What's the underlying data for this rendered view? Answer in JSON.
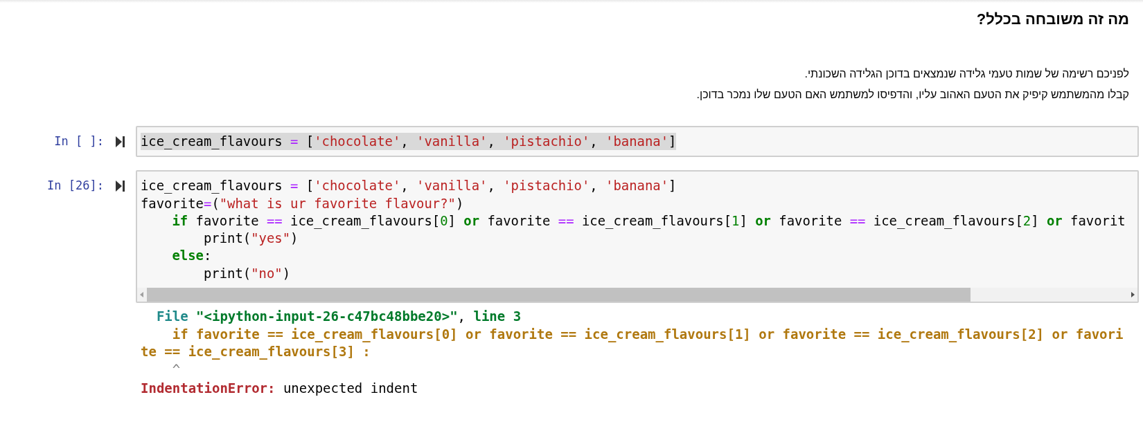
{
  "heading": "מה זה משובחה בכלל?",
  "paragraph": [
    "לפניכם רשימה של שמות טעמי גלידה שנמצאים בדוכן הגלידה השכונתי.",
    "קבלו מהמשתמש קיפיק את הטעם האהוב עליו, והדפיסו למשתמש האם הטעם שלו נמכר בדוכן."
  ],
  "cells": [
    {
      "prompt": "In [ ]:",
      "scrollbar": false,
      "lines": [
        {
          "selected": true,
          "tokens": [
            {
              "kind": "name",
              "text": "ice_cream_flavours "
            },
            {
              "kind": "op",
              "text": "="
            },
            {
              "kind": "name",
              "text": " ["
            },
            {
              "kind": "string",
              "text": "'chocolate'"
            },
            {
              "kind": "name",
              "text": ", "
            },
            {
              "kind": "string",
              "text": "'vanilla'"
            },
            {
              "kind": "name",
              "text": ", "
            },
            {
              "kind": "string",
              "text": "'pistachio'"
            },
            {
              "kind": "name",
              "text": ", "
            },
            {
              "kind": "string",
              "text": "'banana'"
            },
            {
              "kind": "name",
              "text": "]"
            }
          ]
        }
      ]
    },
    {
      "prompt": "In [26]:",
      "scrollbar": true,
      "lines": [
        {
          "selected": false,
          "tokens": [
            {
              "kind": "name",
              "text": "ice_cream_flavours "
            },
            {
              "kind": "op",
              "text": "="
            },
            {
              "kind": "name",
              "text": " ["
            },
            {
              "kind": "string",
              "text": "'chocolate'"
            },
            {
              "kind": "name",
              "text": ", "
            },
            {
              "kind": "string",
              "text": "'vanilla'"
            },
            {
              "kind": "name",
              "text": ", "
            },
            {
              "kind": "string",
              "text": "'pistachio'"
            },
            {
              "kind": "name",
              "text": ", "
            },
            {
              "kind": "string",
              "text": "'banana'"
            },
            {
              "kind": "name",
              "text": "]"
            }
          ]
        },
        {
          "selected": false,
          "tokens": [
            {
              "kind": "name",
              "text": "favorite"
            },
            {
              "kind": "op",
              "text": "="
            },
            {
              "kind": "name",
              "text": "("
            },
            {
              "kind": "string",
              "text": "\"what is ur favorite flavour?\""
            },
            {
              "kind": "name",
              "text": ")"
            }
          ]
        },
        {
          "selected": false,
          "tokens": [
            {
              "kind": "keyword",
              "text": "    if"
            },
            {
              "kind": "name",
              "text": " favorite "
            },
            {
              "kind": "op",
              "text": "=="
            },
            {
              "kind": "name",
              "text": " ice_cream_flavours["
            },
            {
              "kind": "number",
              "text": "0"
            },
            {
              "kind": "name",
              "text": "] "
            },
            {
              "kind": "keyword",
              "text": "or"
            },
            {
              "kind": "name",
              "text": " favorite "
            },
            {
              "kind": "op",
              "text": "=="
            },
            {
              "kind": "name",
              "text": " ice_cream_flavours["
            },
            {
              "kind": "number",
              "text": "1"
            },
            {
              "kind": "name",
              "text": "] "
            },
            {
              "kind": "keyword",
              "text": "or"
            },
            {
              "kind": "name",
              "text": " favorite "
            },
            {
              "kind": "op",
              "text": "=="
            },
            {
              "kind": "name",
              "text": " ice_cream_flavours["
            },
            {
              "kind": "number",
              "text": "2"
            },
            {
              "kind": "name",
              "text": "] "
            },
            {
              "kind": "keyword",
              "text": "or"
            },
            {
              "kind": "name",
              "text": " favorit"
            }
          ]
        },
        {
          "selected": false,
          "tokens": [
            {
              "kind": "name",
              "text": "        print("
            },
            {
              "kind": "string",
              "text": "\"yes\""
            },
            {
              "kind": "name",
              "text": ")"
            }
          ]
        },
        {
          "selected": false,
          "tokens": [
            {
              "kind": "keyword",
              "text": "    else"
            },
            {
              "kind": "name",
              "text": ":"
            }
          ]
        },
        {
          "selected": false,
          "tokens": [
            {
              "kind": "name",
              "text": "        print("
            },
            {
              "kind": "string",
              "text": "\"no\""
            },
            {
              "kind": "name",
              "text": ")"
            }
          ]
        }
      ]
    }
  ],
  "output": [
    {
      "kind": "traceback",
      "tokens": [
        {
          "kind": "file",
          "text": "  File "
        },
        {
          "kind": "path",
          "text": "\"<ipython-input-26-c47bc48bbe20>\""
        },
        {
          "kind": "plain",
          "text": ", "
        },
        {
          "kind": "path",
          "text": "line 3"
        }
      ]
    },
    {
      "kind": "traceback",
      "tokens": [
        {
          "kind": "source",
          "text": "    if favorite == ice_cream_flavours[0] or favorite == ice_cream_flavours[1] or favorite == ice_cream_flavours[2] or favori"
        }
      ]
    },
    {
      "kind": "traceback",
      "tokens": [
        {
          "kind": "source",
          "text": "te == ice_cream_flavours[3] :"
        }
      ]
    },
    {
      "kind": "traceback",
      "tokens": [
        {
          "kind": "caret",
          "text": "    ^"
        }
      ]
    },
    {
      "kind": "error",
      "tokens": [
        {
          "kind": "error",
          "text": "IndentationError:"
        },
        {
          "kind": "plain",
          "text": " unexpected indent"
        }
      ]
    }
  ]
}
